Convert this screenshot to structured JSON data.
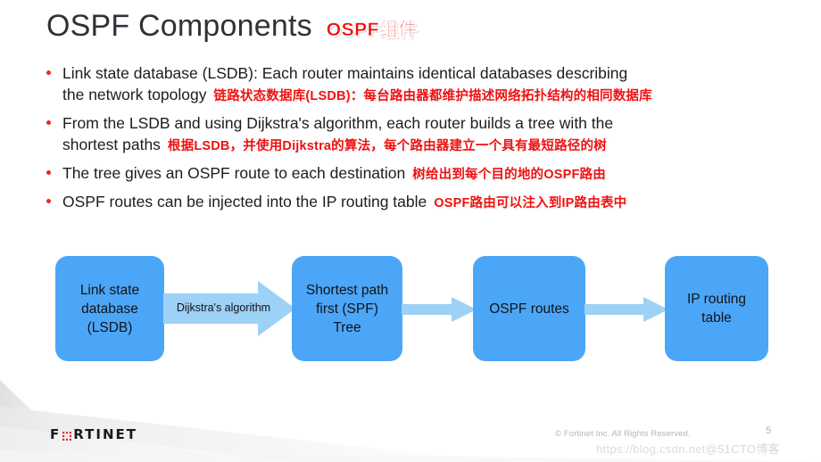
{
  "slide": {
    "title_en": "OSPF Components",
    "title_cn": "OSPF组件",
    "bullets": [
      {
        "en_line1": "Link state database (LSDB): Each router maintains identical databases describing",
        "en_line2": "the network topology",
        "cn": "链路状态数据库(LSDB)：每台路由器都维护描述网络拓扑结构的相同数据库"
      },
      {
        "en_line1": "From the LSDB and using Dijkstra's algorithm, each router builds a tree with the",
        "en_line2": "shortest paths",
        "cn": "根据LSDB，并使用Dijkstra的算法，每个路由器建立一个具有最短路径的树"
      },
      {
        "en_line1": "The tree gives an OSPF route to each destination",
        "en_line2": "",
        "cn": "树给出到每个目的地的OSPF路由"
      },
      {
        "en_line1": "OSPF routes can be injected into the IP routing table",
        "en_line2": "",
        "cn": "OSPF路由可以注入到IP路由表中"
      }
    ],
    "diagram": {
      "nodes": [
        {
          "id": "lsdb",
          "label": "Link state\ndatabase\n(LSDB)"
        },
        {
          "id": "spf",
          "label": "Shortest path\nfirst (SPF)\nTree"
        },
        {
          "id": "routes",
          "label": "OSPF routes"
        },
        {
          "id": "iptab",
          "label": "IP routing\ntable"
        }
      ],
      "arrow_label": "Dijkstra's algorithm",
      "node_color": "#4ca6f8",
      "arrow_color": "#9ed1f6"
    },
    "footer": {
      "logo_text_pre": "F",
      "logo_text_post": "RTINET",
      "logo_icon": "fortinet-dot-matrix-o",
      "copyright": "© Fortinet Inc. All Rights Reserved.",
      "page_number": "5",
      "watermark_url": "https://blog.csdn.net",
      "watermark_tag": "@51CTO博客"
    },
    "colors": {
      "accent_red": "#ee1111",
      "bullet_red": "#e8282a",
      "title_gray": "#2f3237",
      "box_blue": "#4ca6f8",
      "arrow_blue": "#9ed1f6"
    }
  }
}
